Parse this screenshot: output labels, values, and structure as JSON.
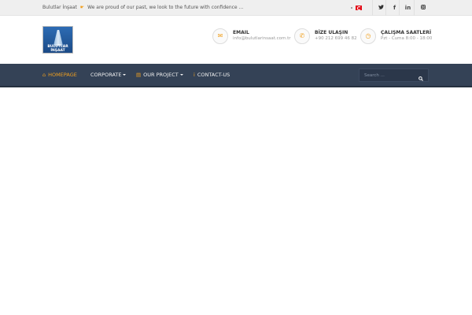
{
  "topbar": {
    "message_brand": "Bulutlar İnşaat",
    "message_text": "We are proud of our past, we look to the future with confidence ...",
    "language_flag": "turkish-flag-icon",
    "social": [
      "twitter-icon",
      "facebook-icon",
      "linkedin-icon",
      "instagram-icon"
    ]
  },
  "logo": {
    "line1": "BULUTLAR",
    "line2": "İNŞAAT"
  },
  "contacts": [
    {
      "icon": "envelope-icon",
      "title": "EMAIL",
      "value": "info@bulutlarinsaat.com.tr"
    },
    {
      "icon": "phone-icon",
      "title": "BİZE ULAŞIN",
      "value": "+90 212 699 46 82"
    },
    {
      "icon": "clock-icon",
      "title": "ÇALIŞMA SAATLERİ",
      "value": "Pzt - Cuma 8:00 - 18:00"
    }
  ],
  "nav": {
    "items": [
      {
        "label": "HOMEPAGE",
        "icon": "home-icon",
        "active": true
      },
      {
        "label": "CORPORATE",
        "dropdown": true
      },
      {
        "label": "OUR PROJECT",
        "icon": "building-icon",
        "dropdown": true
      },
      {
        "label": "CONTACT-US",
        "icon": "info-icon"
      }
    ],
    "search_placeholder": "Search ..."
  },
  "colors": {
    "accent": "#f0a020",
    "nav_bg": "#344256",
    "topbar_bg": "#efefef"
  }
}
